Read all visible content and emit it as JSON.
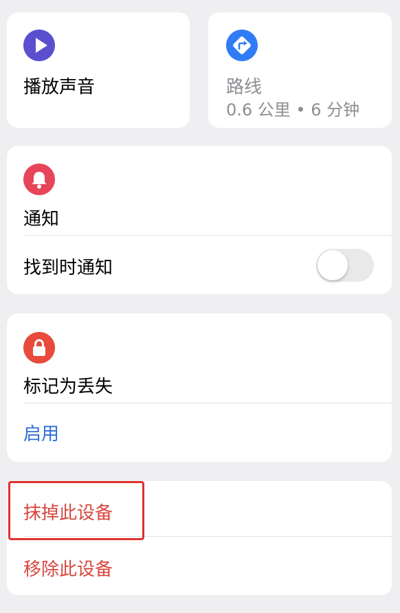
{
  "play_sound": {
    "label": "播放声音",
    "icon": "play-icon",
    "icon_color": "#5a4fcf"
  },
  "route": {
    "label": "路线",
    "subtitle": "0.6 公里 • 6 分钟",
    "icon": "directions-icon",
    "icon_color": "#2f7cf6"
  },
  "notifications": {
    "title": "通知",
    "icon": "bell-icon",
    "icon_color": "#e8455a",
    "notify_when_found": {
      "label": "找到时通知",
      "enabled": false
    }
  },
  "mark_as_lost": {
    "title": "标记为丢失",
    "icon": "lock-icon",
    "icon_color": "#e84a3c",
    "action_label": "启用"
  },
  "device_actions": {
    "erase_label": "抹掉此设备",
    "remove_label": "移除此设备",
    "highlight_color": "#e0312f"
  },
  "colors": {
    "link_blue": "#2c6fd6",
    "destructive_red": "#d8473f",
    "muted_gray": "#8e8e93"
  }
}
